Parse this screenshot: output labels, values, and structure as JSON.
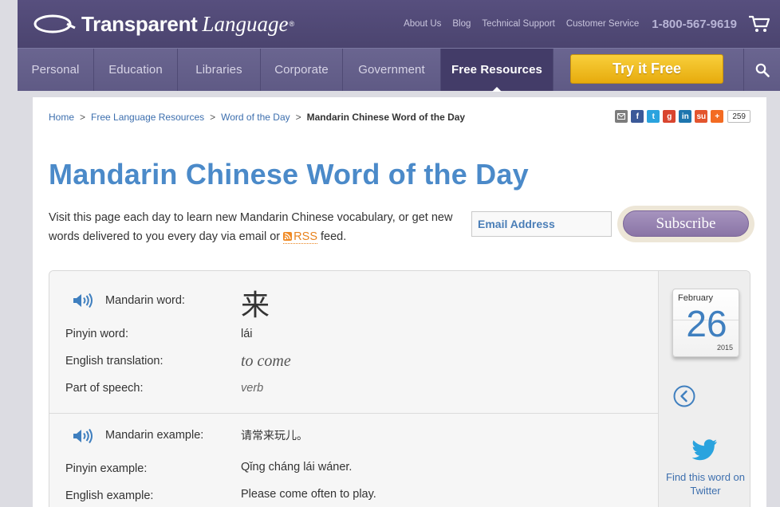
{
  "header": {
    "logo_word1": "Transparent",
    "logo_word2": "Language",
    "logo_reg": "®",
    "util_links": [
      "About Us",
      "Blog",
      "Technical Support",
      "Customer Service"
    ],
    "phone": "1-800-567-9619"
  },
  "nav": {
    "items": [
      "Personal",
      "Education",
      "Libraries",
      "Corporate",
      "Government",
      "Free Resources"
    ],
    "active": "Free Resources",
    "cta": "Try it Free"
  },
  "breadcrumb": {
    "items": [
      "Home",
      "Free Language Resources",
      "Word of the Day"
    ],
    "current": "Mandarin Chinese Word of the Day",
    "separator": ">"
  },
  "share": {
    "count": "259"
  },
  "page": {
    "title": "Mandarin Chinese Word of the Day",
    "intro_part1": "Visit this page each day to learn new Mandarin Chinese vocabulary, or get new words delivered to you every day via email or ",
    "rss_label": "RSS",
    "intro_part2": " feed.",
    "email_placeholder": "Email Address",
    "subscribe_label": "Subscribe"
  },
  "word": {
    "mandarin_label": "Mandarin word:",
    "mandarin_value": "来",
    "pinyin_label": "Pinyin word:",
    "pinyin_value": "lái",
    "english_label": "English translation:",
    "english_value": "to come",
    "pos_label": "Part of speech:",
    "pos_value": "verb",
    "example_label": "Mandarin example:",
    "example_value": "请常来玩儿。",
    "pinyin_example_label": "Pinyin example:",
    "pinyin_example_value": "Qǐng cháng lái wáner.",
    "english_example_label": "English example:",
    "english_example_value": "Please come often to play."
  },
  "calendar": {
    "month": "February",
    "day": "26",
    "year": "2015"
  },
  "twitter": {
    "label": "Find this word on Twitter"
  },
  "colors": {
    "brand_purple": "#574f7e",
    "title_blue": "#4b8ac9",
    "cta_yellow": "#f2bd22",
    "link_blue": "#3d6fae"
  }
}
